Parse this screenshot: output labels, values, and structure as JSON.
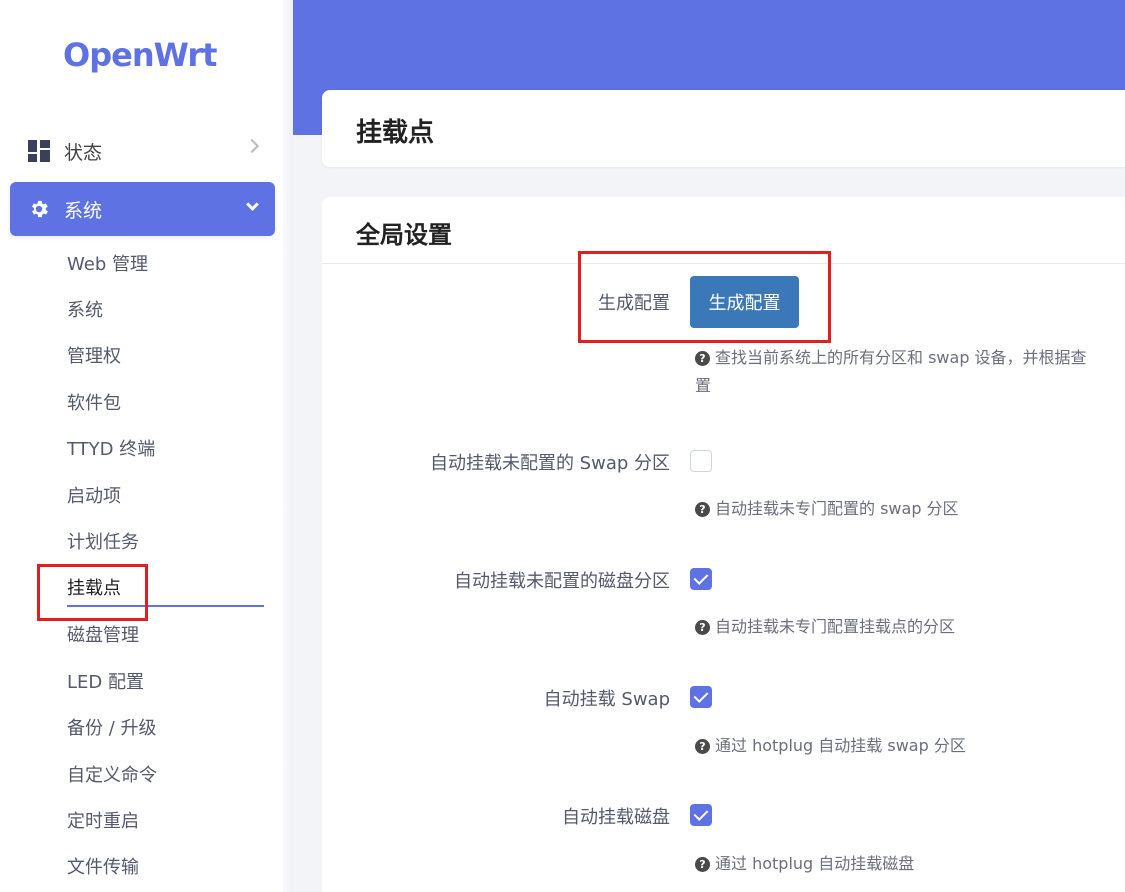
{
  "brand": {
    "logo": "OpenWrt"
  },
  "nav": {
    "status": {
      "label": "状态",
      "icon": "dashboard-grid-icon"
    },
    "system": {
      "label": "系统",
      "icon": "gear-icon"
    },
    "submenu": [
      "Web 管理",
      "系统",
      "管理权",
      "软件包",
      "TTYD 终端",
      "启动项",
      "计划任务",
      "挂载点",
      "磁盘管理",
      "LED 配置",
      "备份 / 升级",
      "自定义命令",
      "定时重启",
      "文件传输"
    ],
    "active_submenu": "挂载点"
  },
  "page": {
    "title": "挂载点"
  },
  "global_settings": {
    "title": "全局设置",
    "generate": {
      "label": "生成配置",
      "button": "生成配置",
      "hint_line1": "查找当前系统上的所有分区和 swap 设备，并根据查",
      "hint_line2": "置"
    },
    "options": [
      {
        "label": "自动挂载未配置的 Swap 分区",
        "checked": false,
        "hint": "自动挂载未专门配置的 swap 分区"
      },
      {
        "label": "自动挂载未配置的磁盘分区",
        "checked": true,
        "hint": "自动挂载未专门配置挂载点的分区"
      },
      {
        "label": "自动挂载 Swap",
        "checked": true,
        "hint": "通过 hotplug 自动挂载 swap 分区"
      },
      {
        "label": "自动挂载磁盘",
        "checked": true,
        "hint": "通过 hotplug 自动挂载磁盘"
      }
    ]
  },
  "colors": {
    "accent": "#5e72e4",
    "button": "#3a78b8",
    "highlight": "#e02020"
  }
}
